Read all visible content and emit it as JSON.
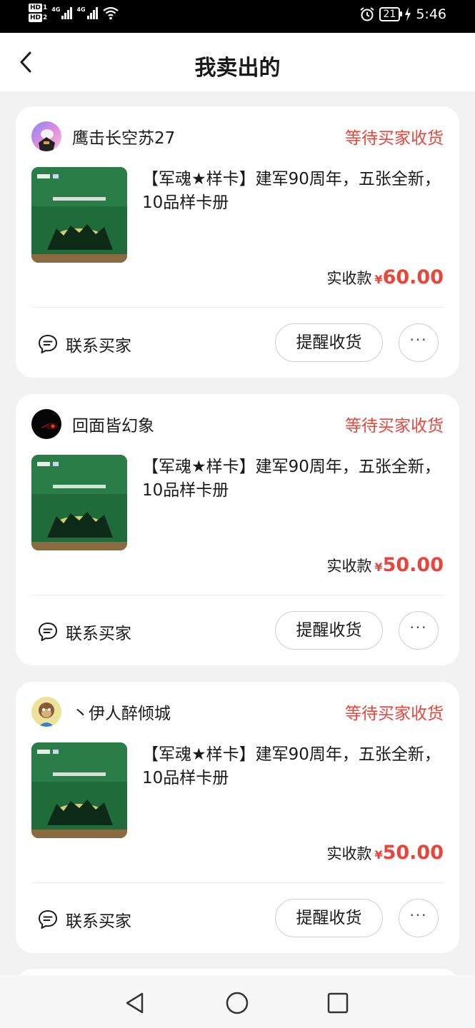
{
  "status_bar": {
    "hd1": "HD",
    "hd1_num": "1",
    "hd2": "HD",
    "hd2_num": "2",
    "net1": "4G",
    "net2": "4G",
    "battery": "21",
    "time": "5:46"
  },
  "header": {
    "title": "我卖出的"
  },
  "orders": [
    {
      "buyer": "鹰击长空苏27",
      "status": "等待买家收货",
      "product_title": "【军魂★样卡】建军90周年，五张全新，10品样卡册",
      "price_label": "实收款",
      "currency": "¥",
      "price": "60.00",
      "contact_label": "联系买家",
      "remind_label": "提醒收货",
      "more_label": "···"
    },
    {
      "buyer": "回面皆幻象",
      "status": "等待买家收货",
      "product_title": "【军魂★样卡】建军90周年，五张全新，10品样卡册",
      "price_label": "实收款",
      "currency": "¥",
      "price": "50.00",
      "contact_label": "联系买家",
      "remind_label": "提醒收货",
      "more_label": "···"
    },
    {
      "buyer": "丶伊人醉倾城",
      "status": "等待买家收货",
      "product_title": "【军魂★样卡】建军90周年，五张全新，10品样卡册",
      "price_label": "实收款",
      "currency": "¥",
      "price": "50.00",
      "contact_label": "联系买家",
      "remind_label": "提醒收货",
      "more_label": "···"
    }
  ],
  "colors": {
    "accent_red": "#e8453c",
    "card_bg": "#ffffff",
    "page_bg": "#f2f2f2"
  },
  "icons": {
    "back": "chevron-left-icon",
    "contact": "chat-bubble-icon",
    "nav_back": "triangle-back-icon",
    "nav_home": "circle-home-icon",
    "nav_recent": "square-recent-icon"
  }
}
